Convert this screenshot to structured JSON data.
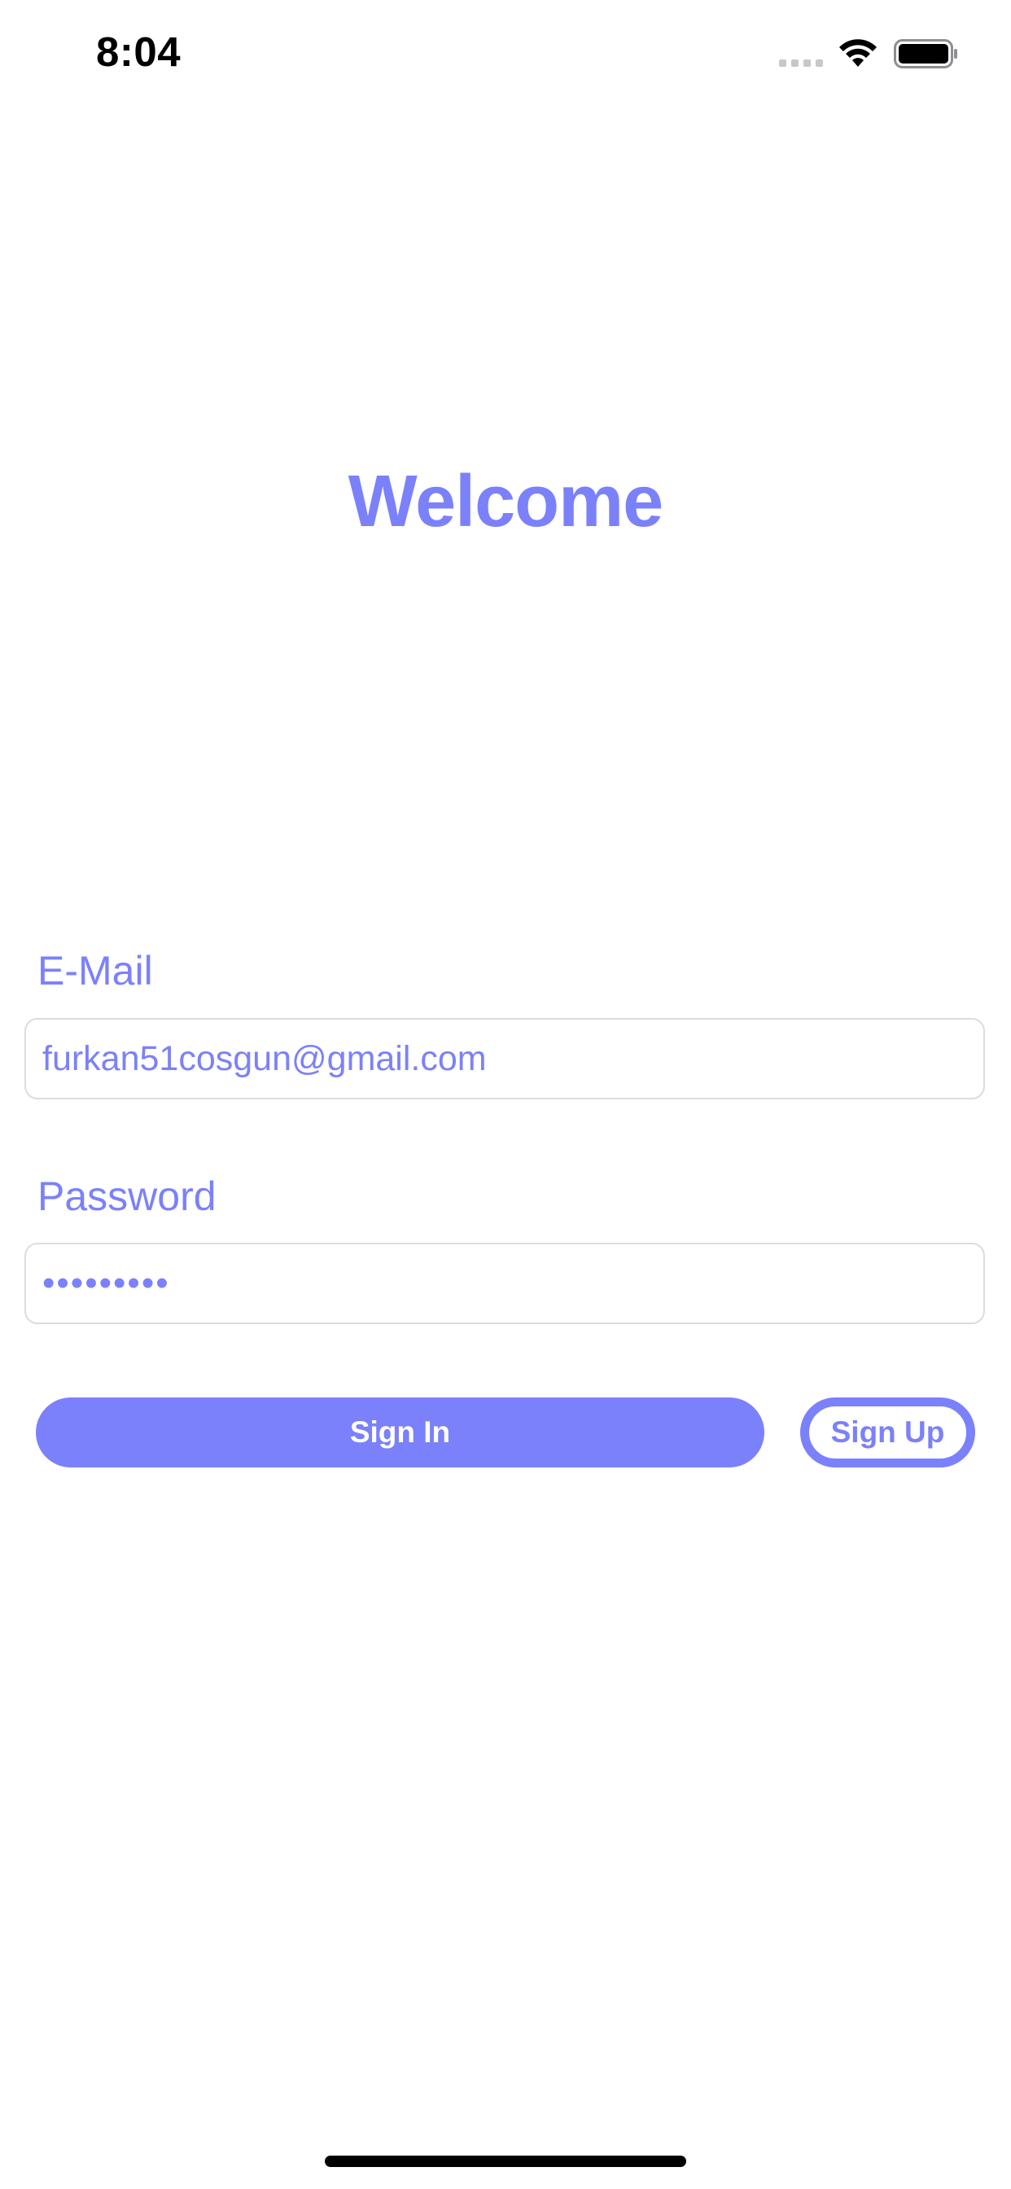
{
  "status_bar": {
    "time": "8:04",
    "signal_icon": "cellular-signal-icon",
    "wifi_icon": "wifi-icon",
    "battery_icon": "battery-icon"
  },
  "header": {
    "title": "Welcome"
  },
  "form": {
    "email": {
      "label": "E-Mail",
      "value": "furkan51cosgun@gmail.com"
    },
    "password": {
      "label": "Password",
      "masked_value": "•••••••••"
    }
  },
  "actions": {
    "sign_in_label": "Sign In",
    "sign_up_label": "Sign Up"
  },
  "colors": {
    "accent": "#7b81fb",
    "field_border": "#dcdce0",
    "background": "#ffffff"
  }
}
